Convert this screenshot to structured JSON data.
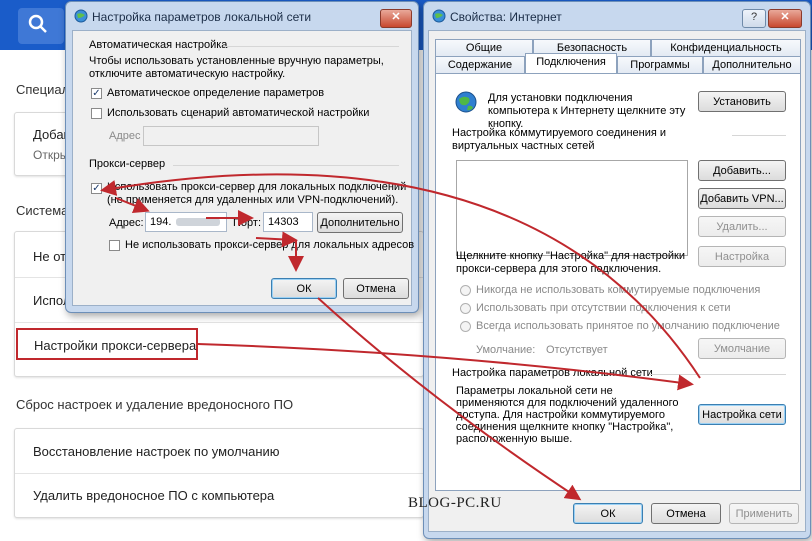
{
  "chrome": {
    "sections": {
      "special": "Специал",
      "system": "Система",
      "reset": "Сброс настроек и удаление вредоносного ПО"
    },
    "special_card": {
      "title": "Добав",
      "subtitle": "Откры"
    },
    "system_rows": [
      "Не от",
      "Испол",
      "Настройки прокси-сервера"
    ],
    "reset_rows": [
      "Восстановление настроек по умолчанию",
      "Удалить вредоносное ПО с компьютера"
    ]
  },
  "lan_dialog": {
    "title": "Настройка параметров локальной сети",
    "auto_group": "Автоматическая настройка",
    "auto_desc": "Чтобы использовать установленные вручную параметры, отключите автоматическую настройку.",
    "auto_detect": "Автоматическое определение параметров",
    "auto_detect_checked": true,
    "use_script": "Использовать сценарий автоматической настройки",
    "use_script_checked": false,
    "address_label": "Адрес",
    "proxy_group": "Прокси-сервер",
    "use_proxy": "Использовать прокси-сервер для локальных подключений (не применяется для удаленных или VPN-подключений).",
    "use_proxy_checked": true,
    "proxy_address_label": "Адрес:",
    "proxy_address_value": "194.",
    "port_label": "Порт:",
    "port_value": "14303",
    "advanced_button": "Дополнительно",
    "bypass_local": "Не использовать прокси-сервер для локальных адресов",
    "bypass_local_checked": false,
    "ok": "ОК",
    "cancel": "Отмена"
  },
  "inet_dialog": {
    "title": "Свойства: Интернет",
    "tabs_row1": [
      "Общие",
      "Безопасность",
      "Конфиденциальность"
    ],
    "tabs_row2": [
      "Содержание",
      "Подключения",
      "Программы",
      "Дополнительно"
    ],
    "active_tab": "Подключения",
    "setup_text": "Для установки подключения компьютера к Интернету щелкните эту кнопку.",
    "setup_button": "Установить",
    "dialup_header": "Настройка коммутируемого соединения и виртуальных частных сетей",
    "add_button": "Добавить...",
    "add_vpn_button": "Добавить VPN...",
    "remove_button": "Удалить...",
    "settings_hint": "Щелкните кнопку \"Настройка\" для настройки прокси-сервера для этого подключения.",
    "settings_button": "Настройка",
    "radio_never": "Никогда не использовать коммутируемые подключения",
    "radio_no_network": "Использовать при отсутствии подключения к сети",
    "radio_always": "Всегда использовать принятое по умолчанию подключение",
    "default_label": "Умолчание:",
    "default_value": "Отсутствует",
    "default_button": "Умолчание",
    "lan_group": "Настройка параметров локальной сети",
    "lan_desc": "Параметры локальной сети не применяются для подключений удаленного доступа. Для настройки коммутируемого соединения щелкните кнопку \"Настройка\", расположенную выше.",
    "lan_button": "Настройка сети",
    "ok": "ОК",
    "cancel": "Отмена",
    "apply": "Применить"
  },
  "watermark": "BLOG-PC.RU",
  "colors": {
    "chrome_bar": "#1a5cc9",
    "arrow": "#c0282d",
    "dialog_frame": "#c7d8ee"
  }
}
